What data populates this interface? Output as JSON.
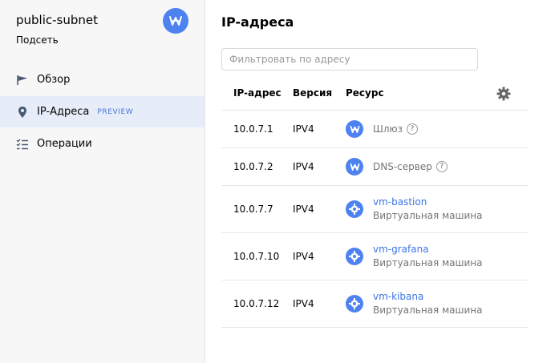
{
  "sidebar": {
    "title": "public-subnet",
    "subtitle": "Подсеть",
    "badge_icon": "gateway-icon",
    "items": [
      {
        "label": "Обзор",
        "icon": "flag-icon",
        "active": false
      },
      {
        "label": "IP-Адреса",
        "icon": "location-pin-icon",
        "active": true,
        "tag": "PREVIEW"
      },
      {
        "label": "Операции",
        "icon": "checklist-icon",
        "active": false
      }
    ]
  },
  "main": {
    "title": "IP-адреса",
    "filter": {
      "placeholder": "Фильтровать по адресу",
      "value": ""
    },
    "columns": {
      "ip": "IP-адрес",
      "version": "Версия",
      "resource": "Ресурс"
    },
    "rows": [
      {
        "ip": "10.0.7.1",
        "version": "IPV4",
        "resource_name": "Шлюз",
        "resource_icon": "gateway-icon",
        "has_help": true
      },
      {
        "ip": "10.0.7.2",
        "version": "IPV4",
        "resource_name": "DNS-сервер",
        "resource_icon": "gateway-icon",
        "has_help": true
      },
      {
        "ip": "10.0.7.7",
        "version": "IPV4",
        "resource_name": "vm-bastion",
        "resource_type": "Виртуальная машина",
        "resource_icon": "vm-chip-icon"
      },
      {
        "ip": "10.0.7.10",
        "version": "IPV4",
        "resource_name": "vm-grafana",
        "resource_type": "Виртуальная машина",
        "resource_icon": "vm-chip-icon"
      },
      {
        "ip": "10.0.7.12",
        "version": "IPV4",
        "resource_name": "vm-kibana",
        "resource_type": "Виртуальная машина",
        "resource_icon": "vm-chip-icon"
      }
    ],
    "help_symbol": "?"
  },
  "colors": {
    "accent": "#4d82f0",
    "link": "#3b74e8",
    "sidebar_bg": "#f7f7f8",
    "active_bg": "#e6ecf8",
    "muted_text": "#757575"
  }
}
